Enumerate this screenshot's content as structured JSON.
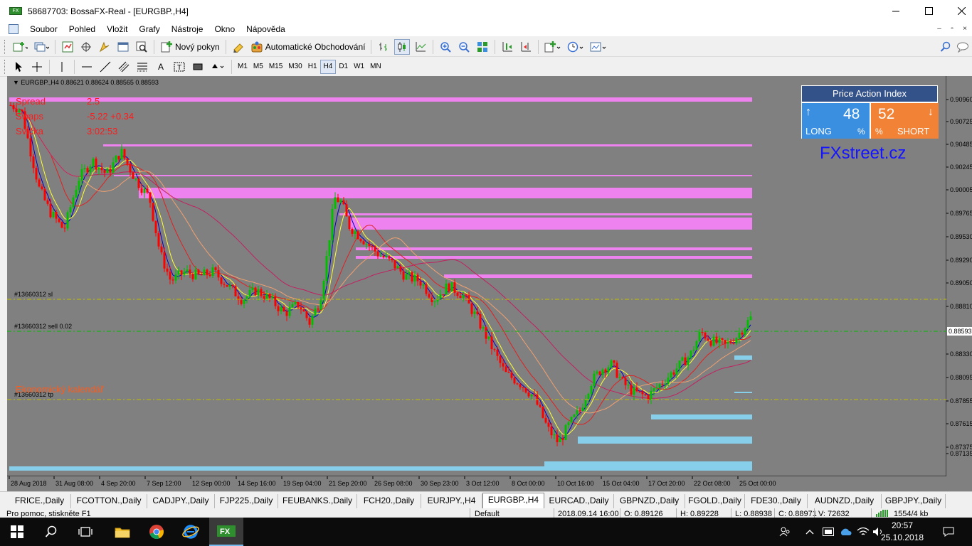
{
  "window": {
    "title": "58687703: BossaFX-Real - [EURGBP.,H4]",
    "app_icon_text": "FX",
    "minimize_icon": "minimize-icon",
    "maximize_icon": "maximize-icon",
    "close_icon": "close-icon"
  },
  "menu": {
    "items": [
      "Soubor",
      "Pohled",
      "Vložit",
      "Grafy",
      "Nástroje",
      "Okno",
      "Nápověda"
    ]
  },
  "toolbar1": {
    "new_order_label": "Nový pokyn",
    "auto_trading_label": "Automatické Obchodování"
  },
  "toolbar2": {
    "timeframes": [
      "M1",
      "M5",
      "M15",
      "M30",
      "H1",
      "H4",
      "D1",
      "W1",
      "MN"
    ],
    "active_timeframe": "H4",
    "text_tool": "A"
  },
  "chart": {
    "header": "EURGBP.,H4  0.88621 0.88624 0.88565 0.88593",
    "info": [
      {
        "label": "Spread",
        "value": "2.5"
      },
      {
        "label": "Swaps",
        "value": "-5.22 +0.34"
      },
      {
        "label": "Svíčka",
        "value": "3:02:53"
      }
    ],
    "lines": {
      "sl": "#13660312 sl",
      "sell": "#13660312 sell 0.02",
      "tp": "#13660312 tp"
    },
    "calendar_label": "Ekonomický kalendář",
    "brand": "FXstreet.cz",
    "price_labels": [
      "0.90960",
      "0.90725",
      "0.90485",
      "0.90245",
      "0.90005",
      "0.89765",
      "0.89530",
      "0.89290",
      "0.89050",
      "0.88810",
      "0.88593",
      "0.88330",
      "0.88095",
      "0.87855",
      "0.87615",
      "0.87375",
      "0.87135"
    ],
    "current_price": "0.88593",
    "time_labels": [
      "28 Aug 2018",
      "31 Aug 08:00",
      "4 Sep 20:00",
      "7 Sep 12:00",
      "12 Sep 00:00",
      "14 Sep 16:00",
      "19 Sep 04:00",
      "21 Sep 20:00",
      "26 Sep 08:00",
      "30 Sep 23:00",
      "3 Oct 12:00",
      "8 Oct 00:00",
      "10 Oct 16:00",
      "15 Oct 04:00",
      "17 Oct 20:00",
      "22 Oct 08:00",
      "25 Oct 00:00"
    ]
  },
  "price_action_index": {
    "title": "Price Action Index",
    "long_value": "48",
    "long_label": "LONG",
    "short_value": "52",
    "short_label": "SHORT",
    "percent": "%",
    "up_arrow": "↑",
    "down_arrow": "↓"
  },
  "tabs": [
    "FRICE.,Daily",
    "FCOTTON.,Daily",
    "CADJPY.,Daily",
    "FJP225.,Daily",
    "FEUBANKS.,Daily",
    "FCH20.,Daily",
    "EURJPY.,H4",
    "EURGBP.,H4",
    "EURCAD.,Daily",
    "GBPNZD.,Daily",
    "FGOLD.,Daily",
    "FDE30.,Daily",
    "AUDNZD.,Daily",
    "GBPJPY.,Daily"
  ],
  "active_tab": "EURGBP.,H4",
  "status": {
    "help": "Pro pomoc, stiskněte F1",
    "profile": "Default",
    "datetime": "2018.09.14 16:00",
    "open": "O: 0.89126",
    "high": "H: 0.89228",
    "low": "L: 0.88938",
    "close": "C: 0.88971",
    "volume": "V: 72632",
    "traffic": "1554/4 kb"
  },
  "taskbar": {
    "time": "20:57",
    "date": "25.10.2018"
  },
  "colors": {
    "chart_bg": "#808080",
    "bull_candle": "#00c000",
    "bear_candle": "#ff0000",
    "resistance_zone": "#ee82ee",
    "support_zone": "#87ceeb",
    "order_line": "#c0c000",
    "sell_line": "#00c000"
  }
}
